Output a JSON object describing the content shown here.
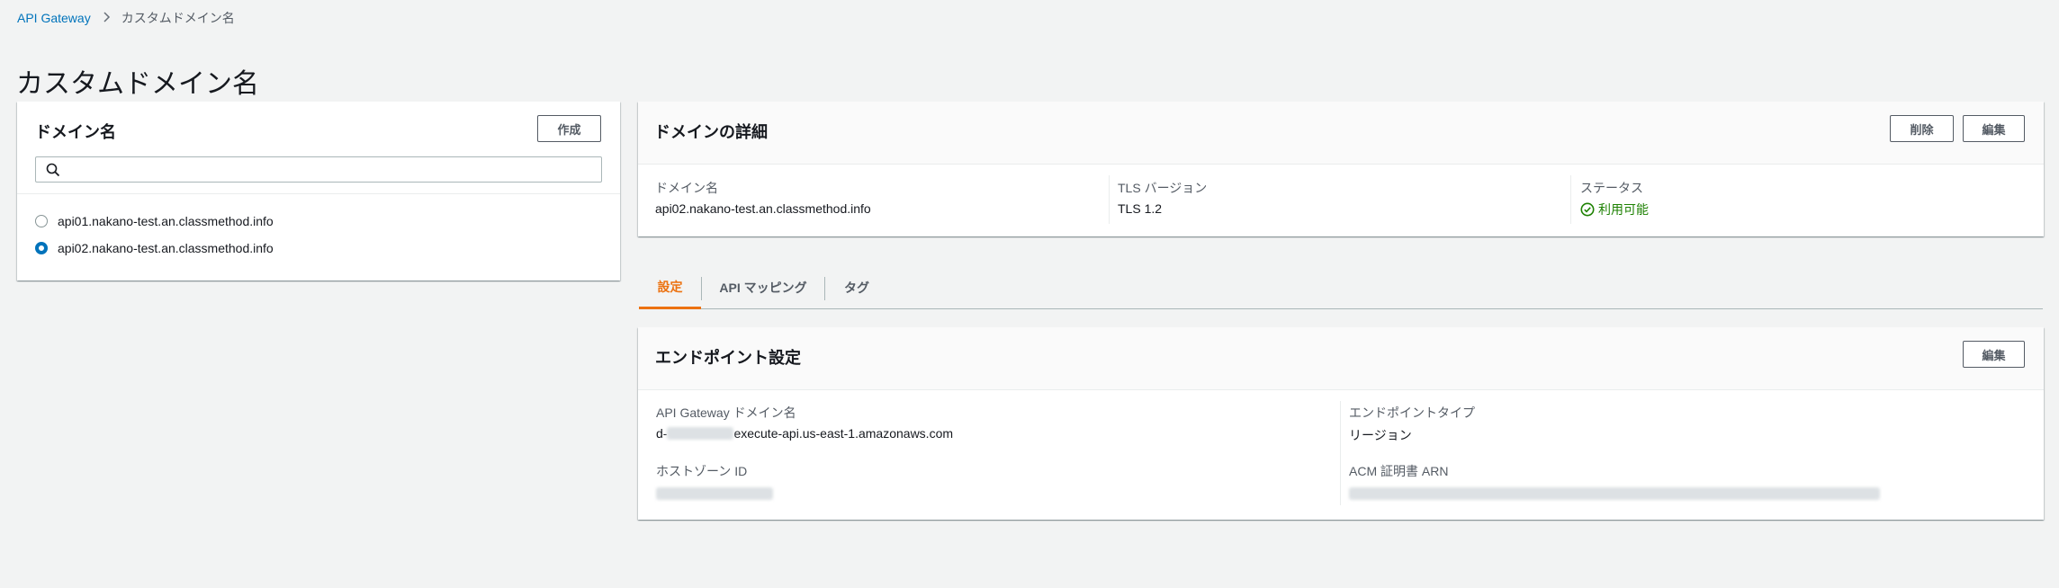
{
  "breadcrumb": {
    "root": "API Gateway",
    "current": "カスタムドメイン名"
  },
  "page_title": "カスタムドメイン名",
  "left_panel": {
    "title": "ドメイン名",
    "create_button": "作成",
    "search_placeholder": "",
    "domains": [
      {
        "label": "api01.nakano-test.an.classmethod.info",
        "selected": false
      },
      {
        "label": "api02.nakano-test.an.classmethod.info",
        "selected": true
      }
    ]
  },
  "detail_panel": {
    "title": "ドメインの詳細",
    "delete_button": "削除",
    "edit_button": "編集",
    "domain_label": "ドメイン名",
    "domain_value": "api02.nakano-test.an.classmethod.info",
    "tls_label": "TLS バージョン",
    "tls_value": "TLS 1.2",
    "status_label": "ステータス",
    "status_value": "利用可能",
    "status_color": "#1d8102"
  },
  "tabs": [
    {
      "label": "設定",
      "active": true
    },
    {
      "label": "API マッピング",
      "active": false
    },
    {
      "label": "タグ",
      "active": false
    }
  ],
  "endpoint_panel": {
    "title": "エンドポイント設定",
    "edit_button": "編集",
    "apigw_domain_label": "API Gateway ドメイン名",
    "apigw_domain_prefix": "d-",
    "apigw_domain_suffix": "execute-api.us-east-1.amazonaws.com",
    "endpoint_type_label": "エンドポイントタイプ",
    "endpoint_type_value": "リージョン",
    "hosted_zone_label": "ホストゾーン ID",
    "acm_arn_label": "ACM 証明書 ARN"
  },
  "colors": {
    "accent": "#0073bb",
    "tab_active": "#ec7211",
    "success": "#1d8102"
  },
  "icons": [
    "chevron-right-icon",
    "search-icon",
    "check-circle-icon"
  ]
}
